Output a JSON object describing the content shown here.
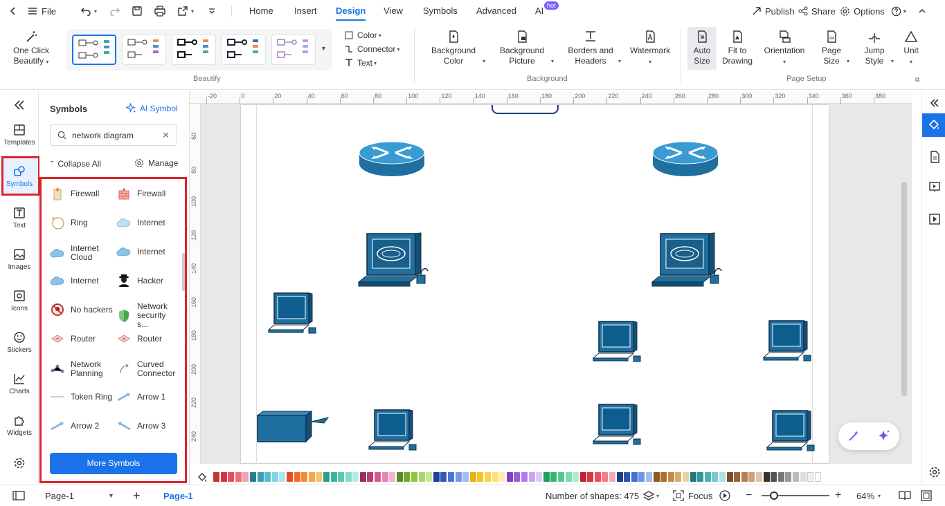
{
  "topbar": {
    "file_label": "File",
    "tabs": [
      {
        "label": "Home",
        "active": false
      },
      {
        "label": "Insert",
        "active": false
      },
      {
        "label": "Design",
        "active": true
      },
      {
        "label": "View",
        "active": false
      },
      {
        "label": "Symbols",
        "active": false
      },
      {
        "label": "Advanced",
        "active": false
      },
      {
        "label": "AI",
        "active": false
      }
    ],
    "hot_badge": "hot",
    "publish": "Publish",
    "share": "Share",
    "options": "Options"
  },
  "ribbon": {
    "one_click_line1": "One Click",
    "one_click_line2": "Beautify",
    "color": "Color",
    "connector": "Connector",
    "text": "Text",
    "group_beautify": "Beautify",
    "background_color_1": "Background",
    "background_color_2": "Color",
    "background_picture_1": "Background",
    "background_picture_2": "Picture",
    "borders_1": "Borders and",
    "borders_2": "Headers",
    "watermark": "Watermark",
    "group_background": "Background",
    "auto_size_1": "Auto",
    "auto_size_2": "Size",
    "fit_1": "Fit to",
    "fit_2": "Drawing",
    "orientation": "Orientation",
    "page_size_1": "Page",
    "page_size_2": "Size",
    "jump_1": "Jump",
    "jump_2": "Style",
    "unit": "Unit",
    "group_page_setup": "Page Setup"
  },
  "rail": {
    "templates": "Templates",
    "symbols": "Symbols",
    "text": "Text",
    "images": "Images",
    "icons": "Icons",
    "stickers": "Stickers",
    "charts": "Charts",
    "widgets": "Widgets"
  },
  "panel": {
    "title": "Symbols",
    "ai_symbol": "AI Symbol",
    "search_value": "network diagram",
    "collapse_all": "Collapse All",
    "manage": "Manage",
    "more_symbols": "More Symbols",
    "items": [
      {
        "label": "Firewall",
        "icon": "firewall-icon"
      },
      {
        "label": "Firewall",
        "icon": "firewall-brick-icon"
      },
      {
        "label": "Ring",
        "icon": "ring-icon"
      },
      {
        "label": "Internet",
        "icon": "cloud-icon"
      },
      {
        "label": "Internet Cloud",
        "icon": "cloud-icon"
      },
      {
        "label": "Internet",
        "icon": "cloud-icon"
      },
      {
        "label": "Internet",
        "icon": "cloud-icon"
      },
      {
        "label": "Hacker",
        "icon": "hacker-icon"
      },
      {
        "label": "No hackers",
        "icon": "no-hackers-icon"
      },
      {
        "label": "Network security s...",
        "icon": "shield-icon"
      },
      {
        "label": "Router",
        "icon": "router-icon"
      },
      {
        "label": "Router",
        "icon": "router-icon"
      },
      {
        "label": "Network Planning",
        "icon": "network-planning-icon"
      },
      {
        "label": "Curved Connector",
        "icon": "curved-connector-icon"
      },
      {
        "label": "Token Ring",
        "icon": "token-ring-icon"
      },
      {
        "label": "Arrow 1",
        "icon": "arrow-icon"
      },
      {
        "label": "Arrow 2",
        "icon": "arrow-icon"
      },
      {
        "label": "Arrow 3",
        "icon": "arrow-icon"
      }
    ]
  },
  "ruler": {
    "h_ticks": [
      "-20",
      "0",
      "20",
      "40",
      "60",
      "80",
      "100",
      "120",
      "140",
      "160",
      "180",
      "200",
      "220",
      "240",
      "260",
      "280",
      "300",
      "320",
      "340",
      "360",
      "380"
    ],
    "v_ticks": [
      "60",
      "80",
      "100",
      "120",
      "140",
      "160",
      "180",
      "200",
      "220",
      "240"
    ]
  },
  "colors": {
    "accent": "#1a73e8",
    "device": "#1f6fa0",
    "highlight_red": "#d9252b",
    "swatches": [
      "#c0392b",
      "#d6304a",
      "#e74c5c",
      "#e87080",
      "#f4a0b0",
      "#2c7d8c",
      "#3aa0b4",
      "#4fc0d0",
      "#7fd6e0",
      "#a8e6ee",
      "#e84b25",
      "#f06a2c",
      "#f58a3c",
      "#f5a84a",
      "#f8c46a",
      "#2a9d8f",
      "#3cb39f",
      "#5cc8b0",
      "#86dcc6",
      "#b4ece0",
      "#9b2d5a",
      "#b83c74",
      "#d65a92",
      "#e884b0",
      "#f4b4d0",
      "#5c8a1e",
      "#74a82a",
      "#8ec63c",
      "#aad862",
      "#c8e896",
      "#2040a0",
      "#3058c0",
      "#4c74d8",
      "#7698e8",
      "#a4bcf4",
      "#e8b010",
      "#f4c420",
      "#f8d44c",
      "#fae07c",
      "#fcecb0",
      "#8040c0",
      "#9c5cd8",
      "#b47ce8",
      "#cca4f0",
      "#e0c8f8",
      "#20a060",
      "#30b870",
      "#50cc8c",
      "#7cdcac",
      "#acecca",
      "#c02030",
      "#d83444",
      "#ec5060",
      "#f47c88",
      "#f8aab4",
      "#1c3c8c",
      "#2c54ac",
      "#4470cc",
      "#6c94e0",
      "#a0bcf0",
      "#8c5a20",
      "#a8702c",
      "#c48c44",
      "#d8ac70",
      "#ecd0a4",
      "#1c7c7c",
      "#2c9898",
      "#48b4b4",
      "#74cccc",
      "#a8e4e4",
      "#7c4c2c",
      "#98643c",
      "#b48054",
      "#cca07c",
      "#e4c4a8",
      "#333333",
      "#555555",
      "#777777",
      "#999999",
      "#bbbbbb",
      "#dddddd",
      "#eeeeee",
      "#ffffff"
    ]
  },
  "status": {
    "page_select": "Page-1",
    "page_tab": "Page-1",
    "shape_count": "Number of shapes: 475",
    "focus": "Focus",
    "zoom": "64%"
  }
}
